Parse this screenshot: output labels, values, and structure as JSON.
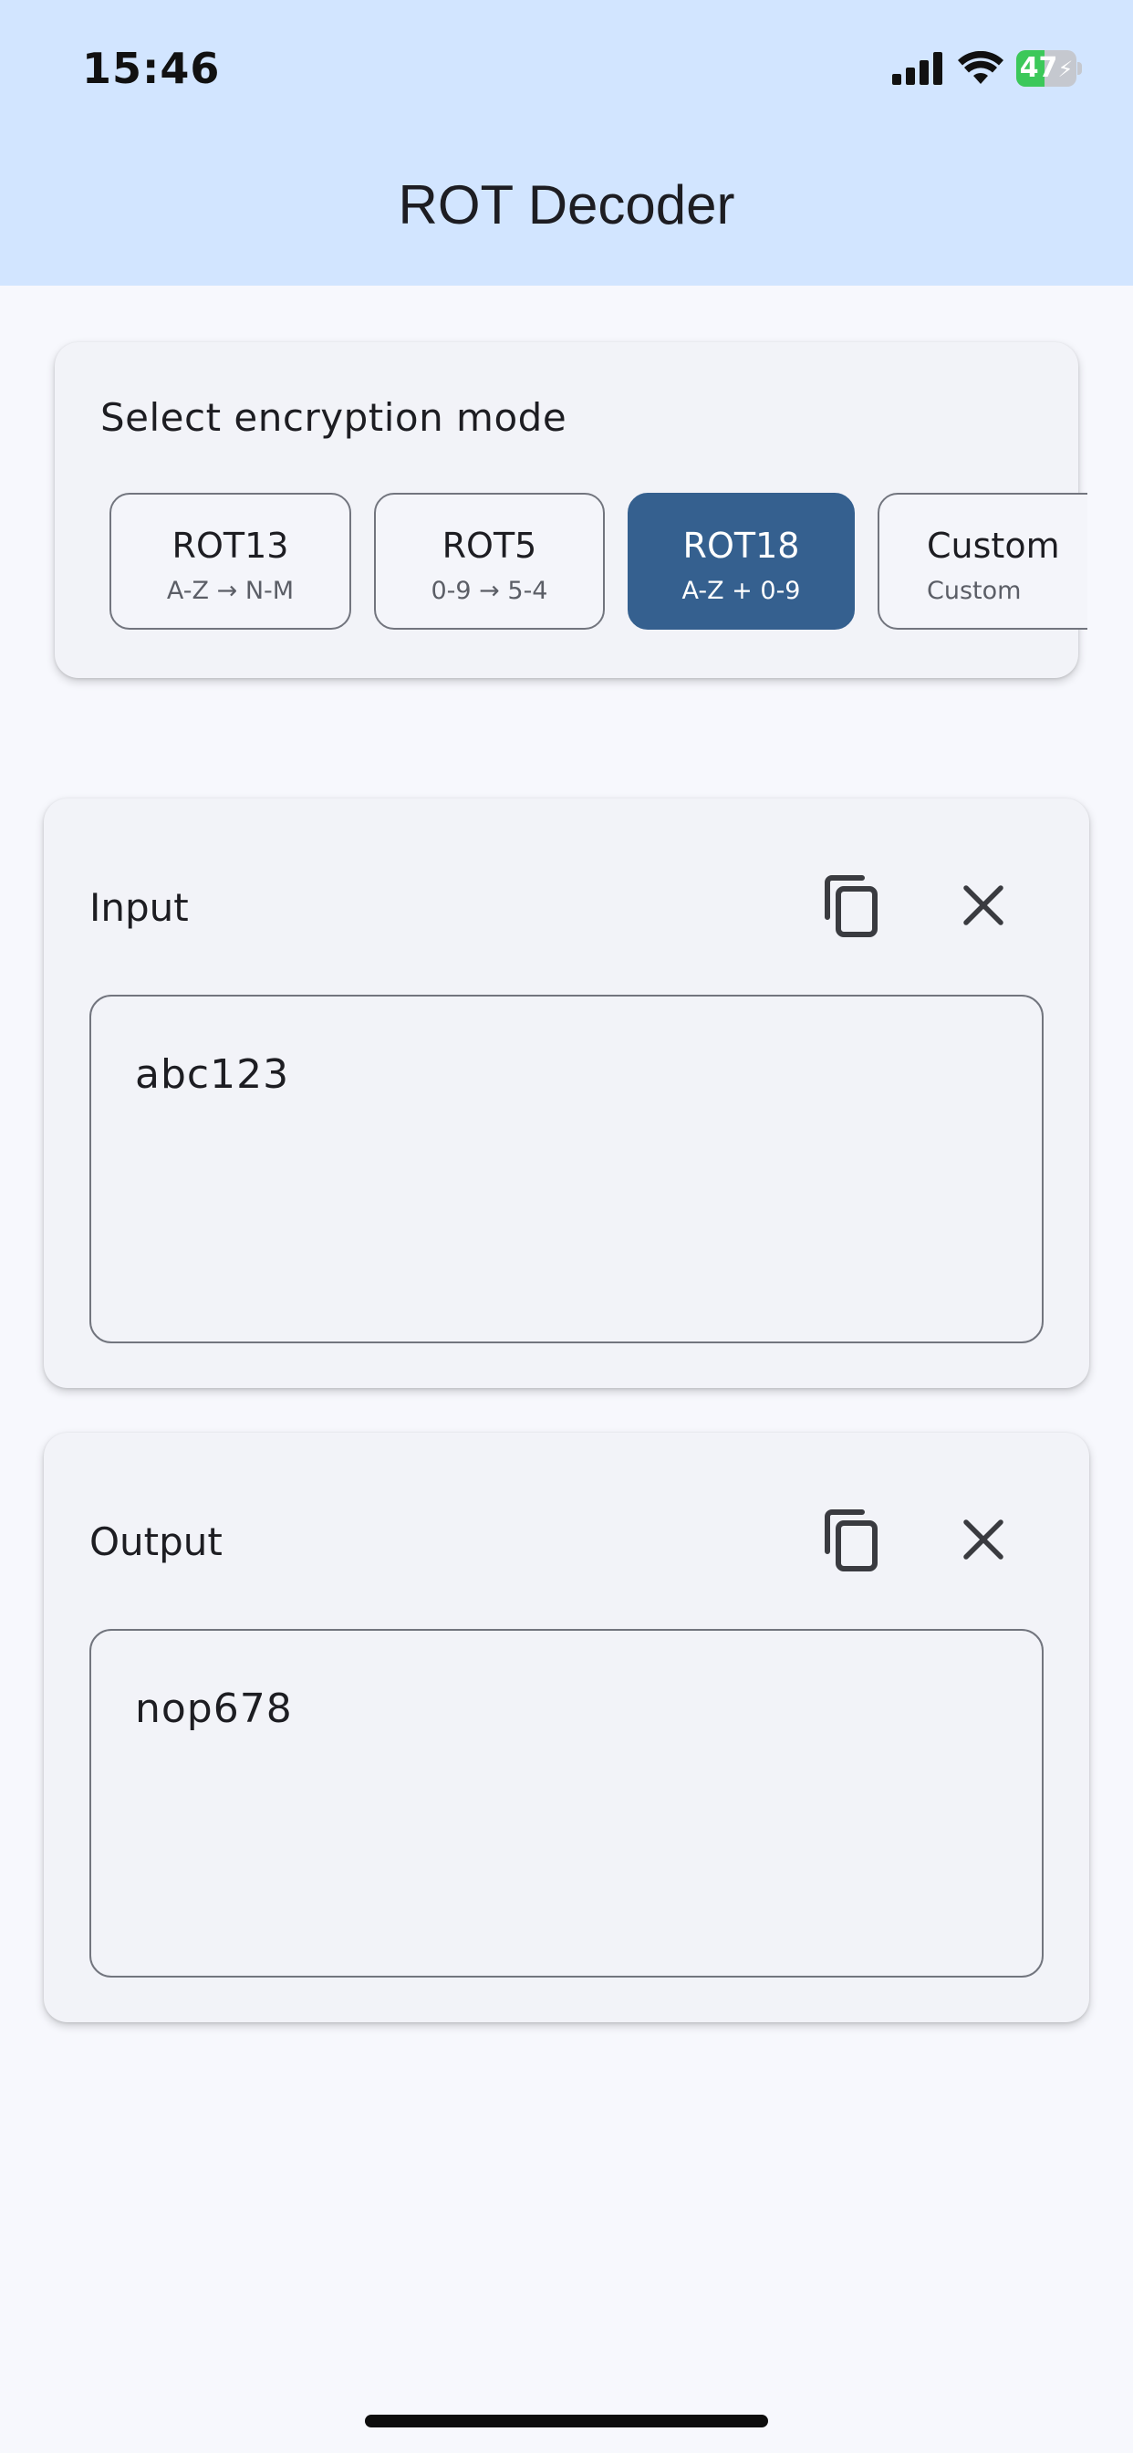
{
  "status_bar": {
    "time": "15:46",
    "battery_level": "47",
    "battery_fraction": 0.47,
    "icons": [
      "cellular-signal-icon",
      "wifi-icon",
      "battery-charging-icon"
    ]
  },
  "app": {
    "title": "ROT Decoder"
  },
  "mode_selector": {
    "title": "Select encryption mode",
    "selected": "ROT18",
    "modes": [
      {
        "label": "ROT13",
        "sub": "A-Z → N-M"
      },
      {
        "label": "ROT5",
        "sub": "0-9 → 5-4"
      },
      {
        "label": "ROT18",
        "sub": "A-Z + 0-9"
      },
      {
        "label": "Custom",
        "sub": "Custom"
      }
    ]
  },
  "input": {
    "label": "Input",
    "value": "abc123"
  },
  "output": {
    "label": "Output",
    "value": "nop678"
  },
  "colors": {
    "header_bg": "#d2e5ff",
    "accent": "#35608f",
    "page_bg": "#f7f8fd",
    "battery_green": "#3cc85a"
  }
}
